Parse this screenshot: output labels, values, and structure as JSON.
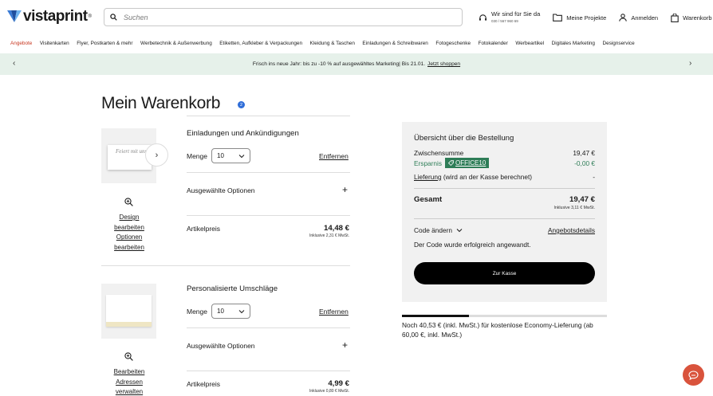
{
  "brand": {
    "name": "vistaprint",
    "reg": "®"
  },
  "search": {
    "placeholder": "Suchen"
  },
  "header_actions": {
    "help_line1": "Wir sind für Sie da",
    "help_line2": "030 / 567 960 69",
    "projects": "Meine Projekte",
    "login": "Anmelden",
    "cart": "Warenkorb"
  },
  "nav": {
    "items": [
      "Angebote",
      "Visitenkarten",
      "Flyer, Postkarten & mehr",
      "Werbetechnik & Außenwerbung",
      "Etiketten, Aufkleber & Verpackungen",
      "Kleidung & Taschen",
      "Einladungen & Schreibwaren",
      "Fotogeschenke",
      "Fotokalender",
      "Werbeartikel",
      "Digitales Marketing",
      "Designservice"
    ]
  },
  "promo": {
    "text": "Frisch ins neue Jahr: bis zu -10 % auf ausgewähltes Marketing| Bis 21.01.",
    "link": "Jetzt shoppen"
  },
  "page": {
    "title": "Mein Warenkorb",
    "count": "2"
  },
  "items": [
    {
      "title": "Einladungen und Ankündigungen",
      "qty_label": "Menge",
      "qty": "10",
      "remove": "Entfernen",
      "options": "Ausgewählte Optionen",
      "price_label": "Artikelpreis",
      "price": "14,48 €",
      "vat": "Inklusive 2,31 € MwSt.",
      "links": [
        "Design",
        "bearbeiten",
        "Optionen",
        "bearbeiten"
      ],
      "card_text": "Feiert mit uns"
    },
    {
      "title": "Personalisierte Umschläge",
      "qty_label": "Menge",
      "qty": "10",
      "remove": "Entfernen",
      "options": "Ausgewählte Optionen",
      "price_label": "Artikelpreis",
      "price": "4,99 €",
      "vat": "Inklusive 0,80 € MwSt.",
      "links": [
        "Bearbeiten",
        "Adressen",
        "verwalten"
      ]
    }
  ],
  "summary": {
    "title": "Übersicht über die Bestellung",
    "subtotal_label": "Zwischensumme",
    "subtotal": "19,47 €",
    "savings_label": "Ersparnis",
    "coupon": "OFFICE10",
    "savings": "-0,00 €",
    "shipping_link": "Lieferung",
    "shipping_note": "(wird an der Kasse berechnet)",
    "shipping": "-",
    "total_label": "Gesamt",
    "total": "19,47 €",
    "total_vat": "Inklusive 3,11 € MwSt.",
    "change_code": "Code ändern",
    "offer_details": "Angebotsdetails",
    "code_ok": "Der Code wurde erfolgreich angewandt.",
    "checkout": "Zur Kasse"
  },
  "shipping_progress": {
    "fraction": 0.325,
    "text": "Noch 40,53 € (inkl. MwSt.) für kostenlose Economy-Lieferung (ab 60,00 €, inkl. MwSt.)"
  },
  "colors": {
    "accent_green": "#2e7d57",
    "promo_bg": "#e6f1ea",
    "nav_active": "#c7361f",
    "chat": "#d9533c"
  }
}
